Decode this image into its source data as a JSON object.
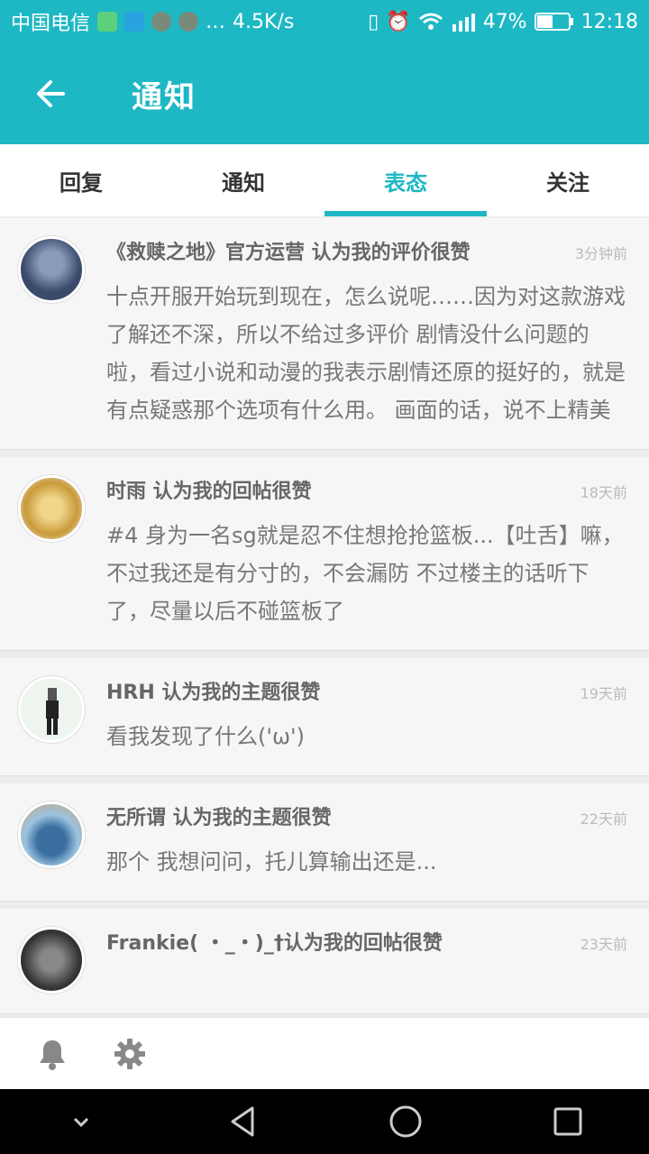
{
  "status_bar": {
    "carrier": "中国电信",
    "speed": "4.5K/s",
    "battery": "47%",
    "time": "12:18",
    "icons": [
      "shield-icon",
      "tap-icon",
      "app-icon",
      "app-icon",
      "more-icon",
      "vibrate-icon",
      "alarm-icon",
      "wifi-icon",
      "signal-icon",
      "battery-icon"
    ]
  },
  "header": {
    "title": "通知"
  },
  "tabs": [
    {
      "label": "回复",
      "active": false
    },
    {
      "label": "通知",
      "active": false
    },
    {
      "label": "表态",
      "active": true
    },
    {
      "label": "关注",
      "active": false
    }
  ],
  "items": [
    {
      "title": "《救赎之地》官方运营 认为我的评价很赞",
      "time": "3分钟前",
      "body": "十点开服开始玩到现在，怎么说呢……因为对这款游戏了解还不深，所以不给过多评价 剧情没什么问题的啦，看过小说和动漫的我表示剧情还原的挺好的，就是有点疑惑那个选项有什么用。 画面的话，说不上精美",
      "avatar_color": "#3a4a6a"
    },
    {
      "title": "时雨 认为我的回帖很赞",
      "time": "18天前",
      "body": "#4 身为一名sg就是忍不住想抢抢篮板...【吐舌】嘛，不过我还是有分寸的，不会漏防 不过楼主的话听下了，尽量以后不碰篮板了",
      "avatar_color": "#c89a3a"
    },
    {
      "title": "HRH 认为我的主题很赞",
      "time": "19天前",
      "body": "看我发现了什么('ω')",
      "avatar_color": "#d9e8d9"
    },
    {
      "title": "无所谓 认为我的主题很赞",
      "time": "22天前",
      "body": "那个 我想问问，托儿算输出还是...",
      "avatar_color": "#5a8ab0"
    },
    {
      "title": "Frankie( ・_・)_†认为我的回帖很赞",
      "time": "23天前",
      "body": "",
      "avatar_color": "#444444"
    }
  ],
  "bottom_bar": {
    "icons": [
      "bell-icon",
      "gear-icon"
    ]
  },
  "nav_bar": {
    "icons": [
      "chevron-down-icon",
      "back-triangle-icon",
      "home-circle-icon",
      "recents-square-icon"
    ]
  },
  "colors": {
    "accent": "#1db8c4"
  }
}
